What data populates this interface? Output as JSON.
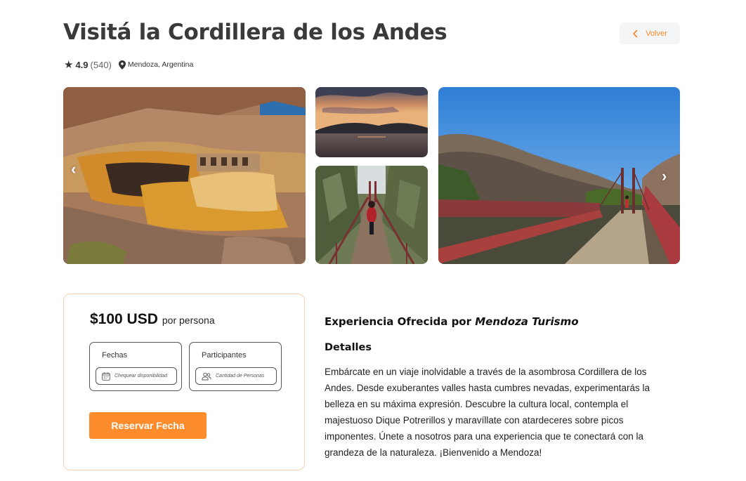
{
  "header": {
    "title": "Visitá la Cordillera de los Andes",
    "back_label": "Volver"
  },
  "meta": {
    "rating": "4.9",
    "reviews": "(540)",
    "location": "Mendoza, Argentina"
  },
  "gallery": {
    "icons": [
      "chevron-left-icon",
      "chevron-right-icon"
    ]
  },
  "booking": {
    "price": "$100 USD",
    "per_label": "por persona",
    "dates_label": "Fechas",
    "dates_placeholder": "Chequear disponibilidad",
    "participants_label": "Participantes",
    "participants_placeholder": "Cantidad de Personas",
    "reserve_label": "Reservar Fecha"
  },
  "info": {
    "offered_prefix": "Experiencia Ofrecida por",
    "offered_by": "Mendoza Turismo",
    "details_heading": "Detalles",
    "description": "Embárcate en un viaje inolvidable a través de la asombrosa Cordillera de los Andes. Desde exuberantes valles hasta cumbres nevadas, experimentarás la belleza en su máxima expresión. Descubre la cultura local, contempla el majestuoso Dique Potrerillos y maravíllate con atardeceres sobre picos imponentes. Únete a nosotros para una experiencia que te conectará con la grandeza de la naturaleza. ¡Bienvenido a Mendoza!"
  },
  "colors": {
    "accent": "#fd8c2c",
    "back_text": "#f7892b",
    "card_border": "#f6d3b0"
  }
}
